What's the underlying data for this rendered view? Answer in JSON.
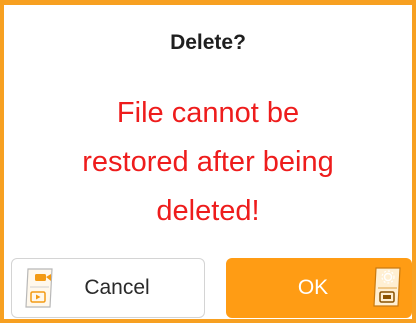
{
  "dialog": {
    "title": "Delete?",
    "message_lines": [
      "File cannot be",
      "restored after being",
      "deleted!"
    ]
  },
  "buttons": {
    "cancel": {
      "label": "Cancel",
      "icon": "video-card-icon"
    },
    "ok": {
      "label": "OK",
      "icon": "settings-card-icon"
    }
  },
  "colors": {
    "accent": "#ff9c14",
    "border": "#f7a021",
    "message": "#ee1c1c",
    "title": "#1f1f1f"
  }
}
